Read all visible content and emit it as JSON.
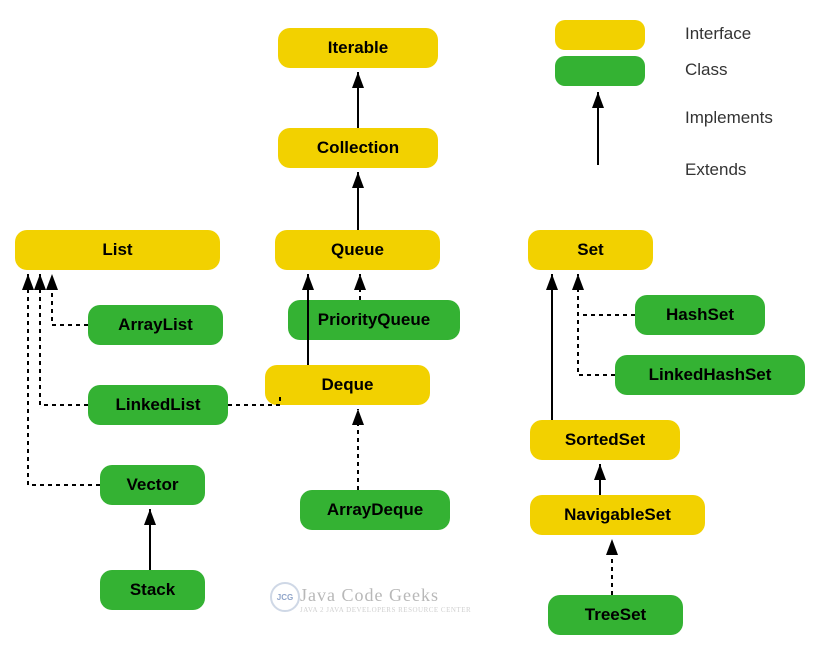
{
  "legend": {
    "interface": "Interface",
    "class": "Class",
    "implements": "Implements",
    "extends": "Extends"
  },
  "nodes": {
    "iterable": "Iterable",
    "collection": "Collection",
    "list": "List",
    "queue": "Queue",
    "set": "Set",
    "arraylist": "ArrayList",
    "linkedlist": "LinkedList",
    "vector": "Vector",
    "stack": "Stack",
    "priorityqueue": "PriorityQueue",
    "deque": "Deque",
    "arraydeque": "ArrayDeque",
    "hashset": "HashSet",
    "linkedhashset": "LinkedHashSet",
    "sortedset": "SortedSet",
    "navigableset": "NavigableSet",
    "treeset": "TreeSet"
  },
  "watermark": {
    "main": "Java Code Geeks",
    "sub": "JAVA 2 JAVA DEVELOPERS RESOURCE CENTER",
    "badge": "JCG"
  },
  "colors": {
    "interface": "#f2d100",
    "class": "#34b233"
  },
  "diagram": {
    "edges": [
      {
        "from": "collection",
        "to": "iterable",
        "style": "extends"
      },
      {
        "from": "list",
        "to": "collection",
        "style": "extends"
      },
      {
        "from": "queue",
        "to": "collection",
        "style": "extends"
      },
      {
        "from": "set",
        "to": "collection",
        "style": "extends"
      },
      {
        "from": "arraylist",
        "to": "list",
        "style": "implements"
      },
      {
        "from": "linkedlist",
        "to": "list",
        "style": "implements"
      },
      {
        "from": "linkedlist",
        "to": "deque",
        "style": "implements"
      },
      {
        "from": "vector",
        "to": "list",
        "style": "implements"
      },
      {
        "from": "stack",
        "to": "vector",
        "style": "extends"
      },
      {
        "from": "priorityqueue",
        "to": "queue",
        "style": "implements"
      },
      {
        "from": "deque",
        "to": "queue",
        "style": "extends"
      },
      {
        "from": "arraydeque",
        "to": "deque",
        "style": "implements"
      },
      {
        "from": "hashset",
        "to": "set",
        "style": "implements"
      },
      {
        "from": "linkedhashset",
        "to": "set",
        "style": "implements"
      },
      {
        "from": "sortedset",
        "to": "set",
        "style": "extends"
      },
      {
        "from": "navigableset",
        "to": "sortedset",
        "style": "extends"
      },
      {
        "from": "treeset",
        "to": "navigableset",
        "style": "implements"
      }
    ]
  }
}
